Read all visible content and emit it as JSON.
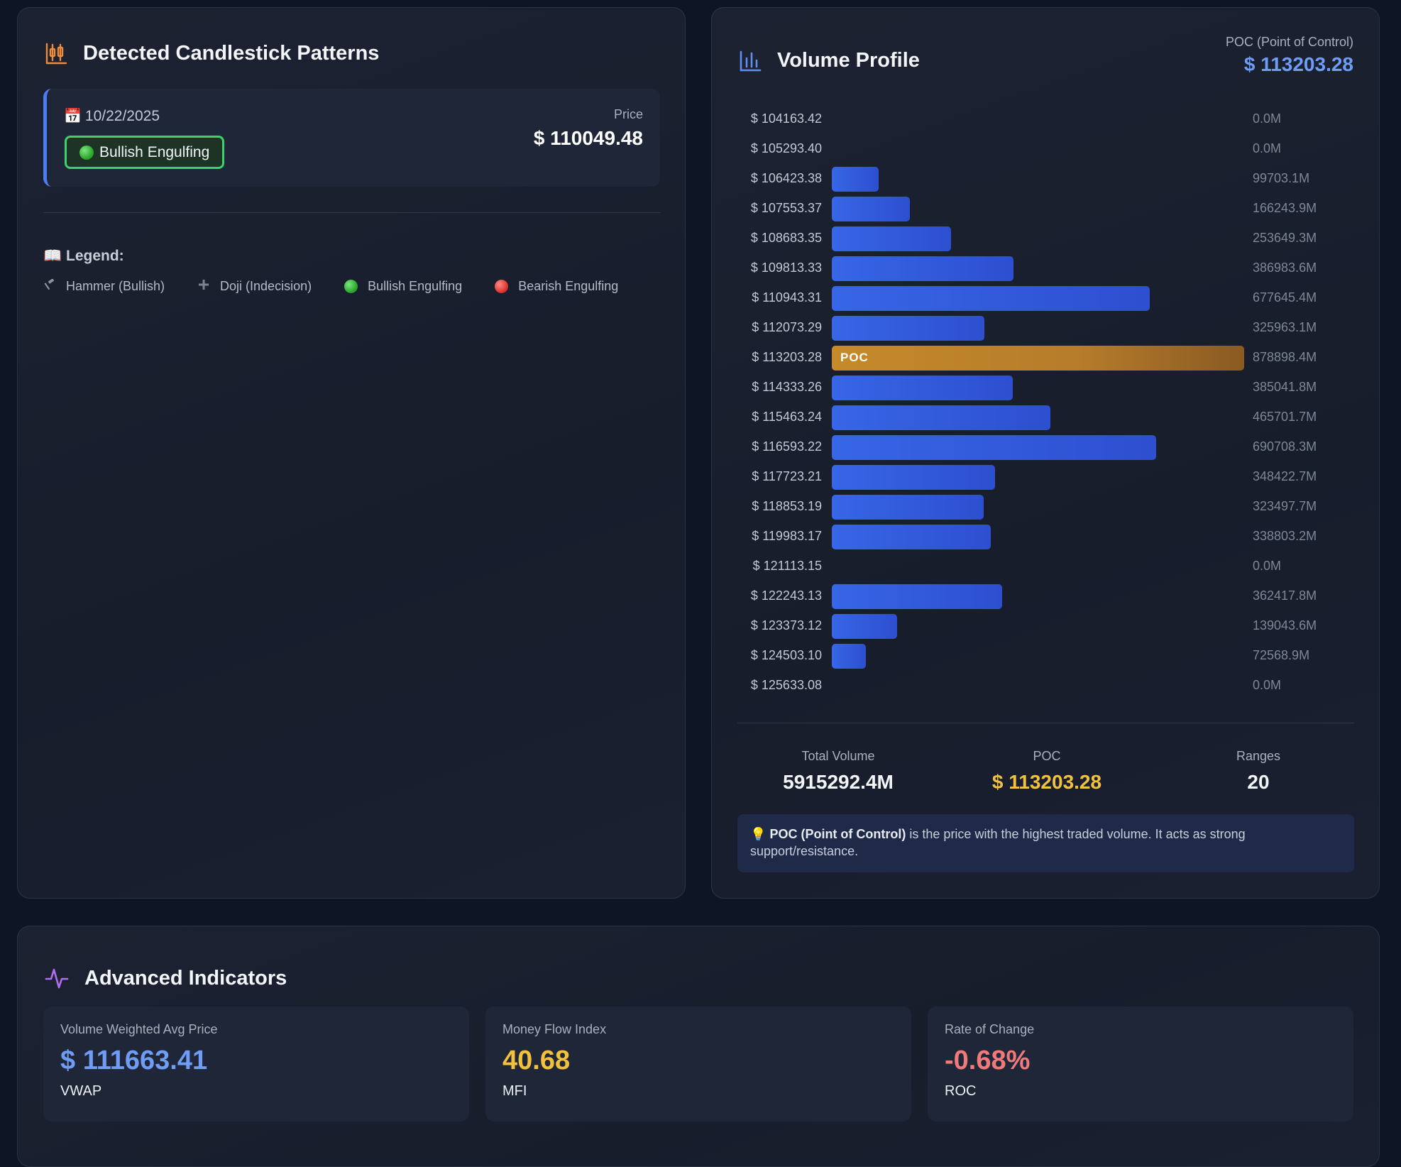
{
  "candlestick": {
    "title": "Detected Candlestick Patterns",
    "pattern": {
      "date": "10/22/2025",
      "name": "Bullish Engulfing",
      "price_label": "Price",
      "price": "$ 110049.48"
    },
    "legend_title": "Legend:",
    "legend": [
      {
        "icon": "hammer-icon",
        "label": "Hammer (Bullish)"
      },
      {
        "icon": "plus-icon",
        "label": "Doji (Indecision)"
      },
      {
        "icon": "green-circle-icon",
        "label": "Bullish Engulfing"
      },
      {
        "icon": "red-circle-icon",
        "label": "Bearish Engulfing"
      }
    ]
  },
  "volume_profile": {
    "title": "Volume Profile",
    "poc_label": "POC (Point of Control)",
    "poc_value": "$ 113203.28",
    "poc_bar_label": "POC",
    "stats": {
      "total_volume_label": "Total Volume",
      "total_volume": "5915292.4M",
      "poc_label": "POC",
      "poc": "$ 113203.28",
      "ranges_label": "Ranges",
      "ranges": "20"
    },
    "note_bold": "POC (Point of Control)",
    "note_text": " is the price with the highest traded volume. It acts as strong support/resistance."
  },
  "chart_data": {
    "type": "bar",
    "orientation": "horizontal",
    "categories": [
      "$ 104163.42",
      "$ 105293.40",
      "$ 106423.38",
      "$ 107553.37",
      "$ 108683.35",
      "$ 109813.33",
      "$ 110943.31",
      "$ 112073.29",
      "$ 113203.28",
      "$ 114333.26",
      "$ 115463.24",
      "$ 116593.22",
      "$ 117723.21",
      "$ 118853.19",
      "$ 119983.17",
      "$ 121113.15",
      "$ 122243.13",
      "$ 123373.12",
      "$ 124503.10",
      "$ 125633.08"
    ],
    "values": [
      0.0,
      0.0,
      99703.1,
      166243.9,
      253649.3,
      386983.6,
      677645.4,
      325963.1,
      878898.4,
      385041.8,
      465701.7,
      690708.3,
      348422.7,
      323497.7,
      338803.2,
      0.0,
      362417.8,
      139043.6,
      72568.9,
      0.0
    ],
    "value_labels": [
      "0.0M",
      "0.0M",
      "99703.1M",
      "166243.9M",
      "253649.3M",
      "386983.6M",
      "677645.4M",
      "325963.1M",
      "878898.4M",
      "385041.8M",
      "465701.7M",
      "690708.3M",
      "348422.7M",
      "323497.7M",
      "338803.2M",
      "0.0M",
      "362417.8M",
      "139043.6M",
      "72568.9M",
      "0.0M"
    ],
    "highlight_index": 8,
    "colors": {
      "bar": "#3766e6",
      "poc": "#c58a2a"
    }
  },
  "indicators": {
    "title": "Advanced Indicators",
    "items": [
      {
        "label": "Volume Weighted Avg Price",
        "value": "$ 111663.41",
        "abbr": "VWAP",
        "color": "#6f9cf4"
      },
      {
        "label": "Money Flow Index",
        "value": "40.68",
        "abbr": "MFI",
        "color": "#f2c23d"
      },
      {
        "label": "Rate of Change",
        "value": "-0.68%",
        "abbr": "ROC",
        "color": "#f07a7a"
      }
    ]
  }
}
